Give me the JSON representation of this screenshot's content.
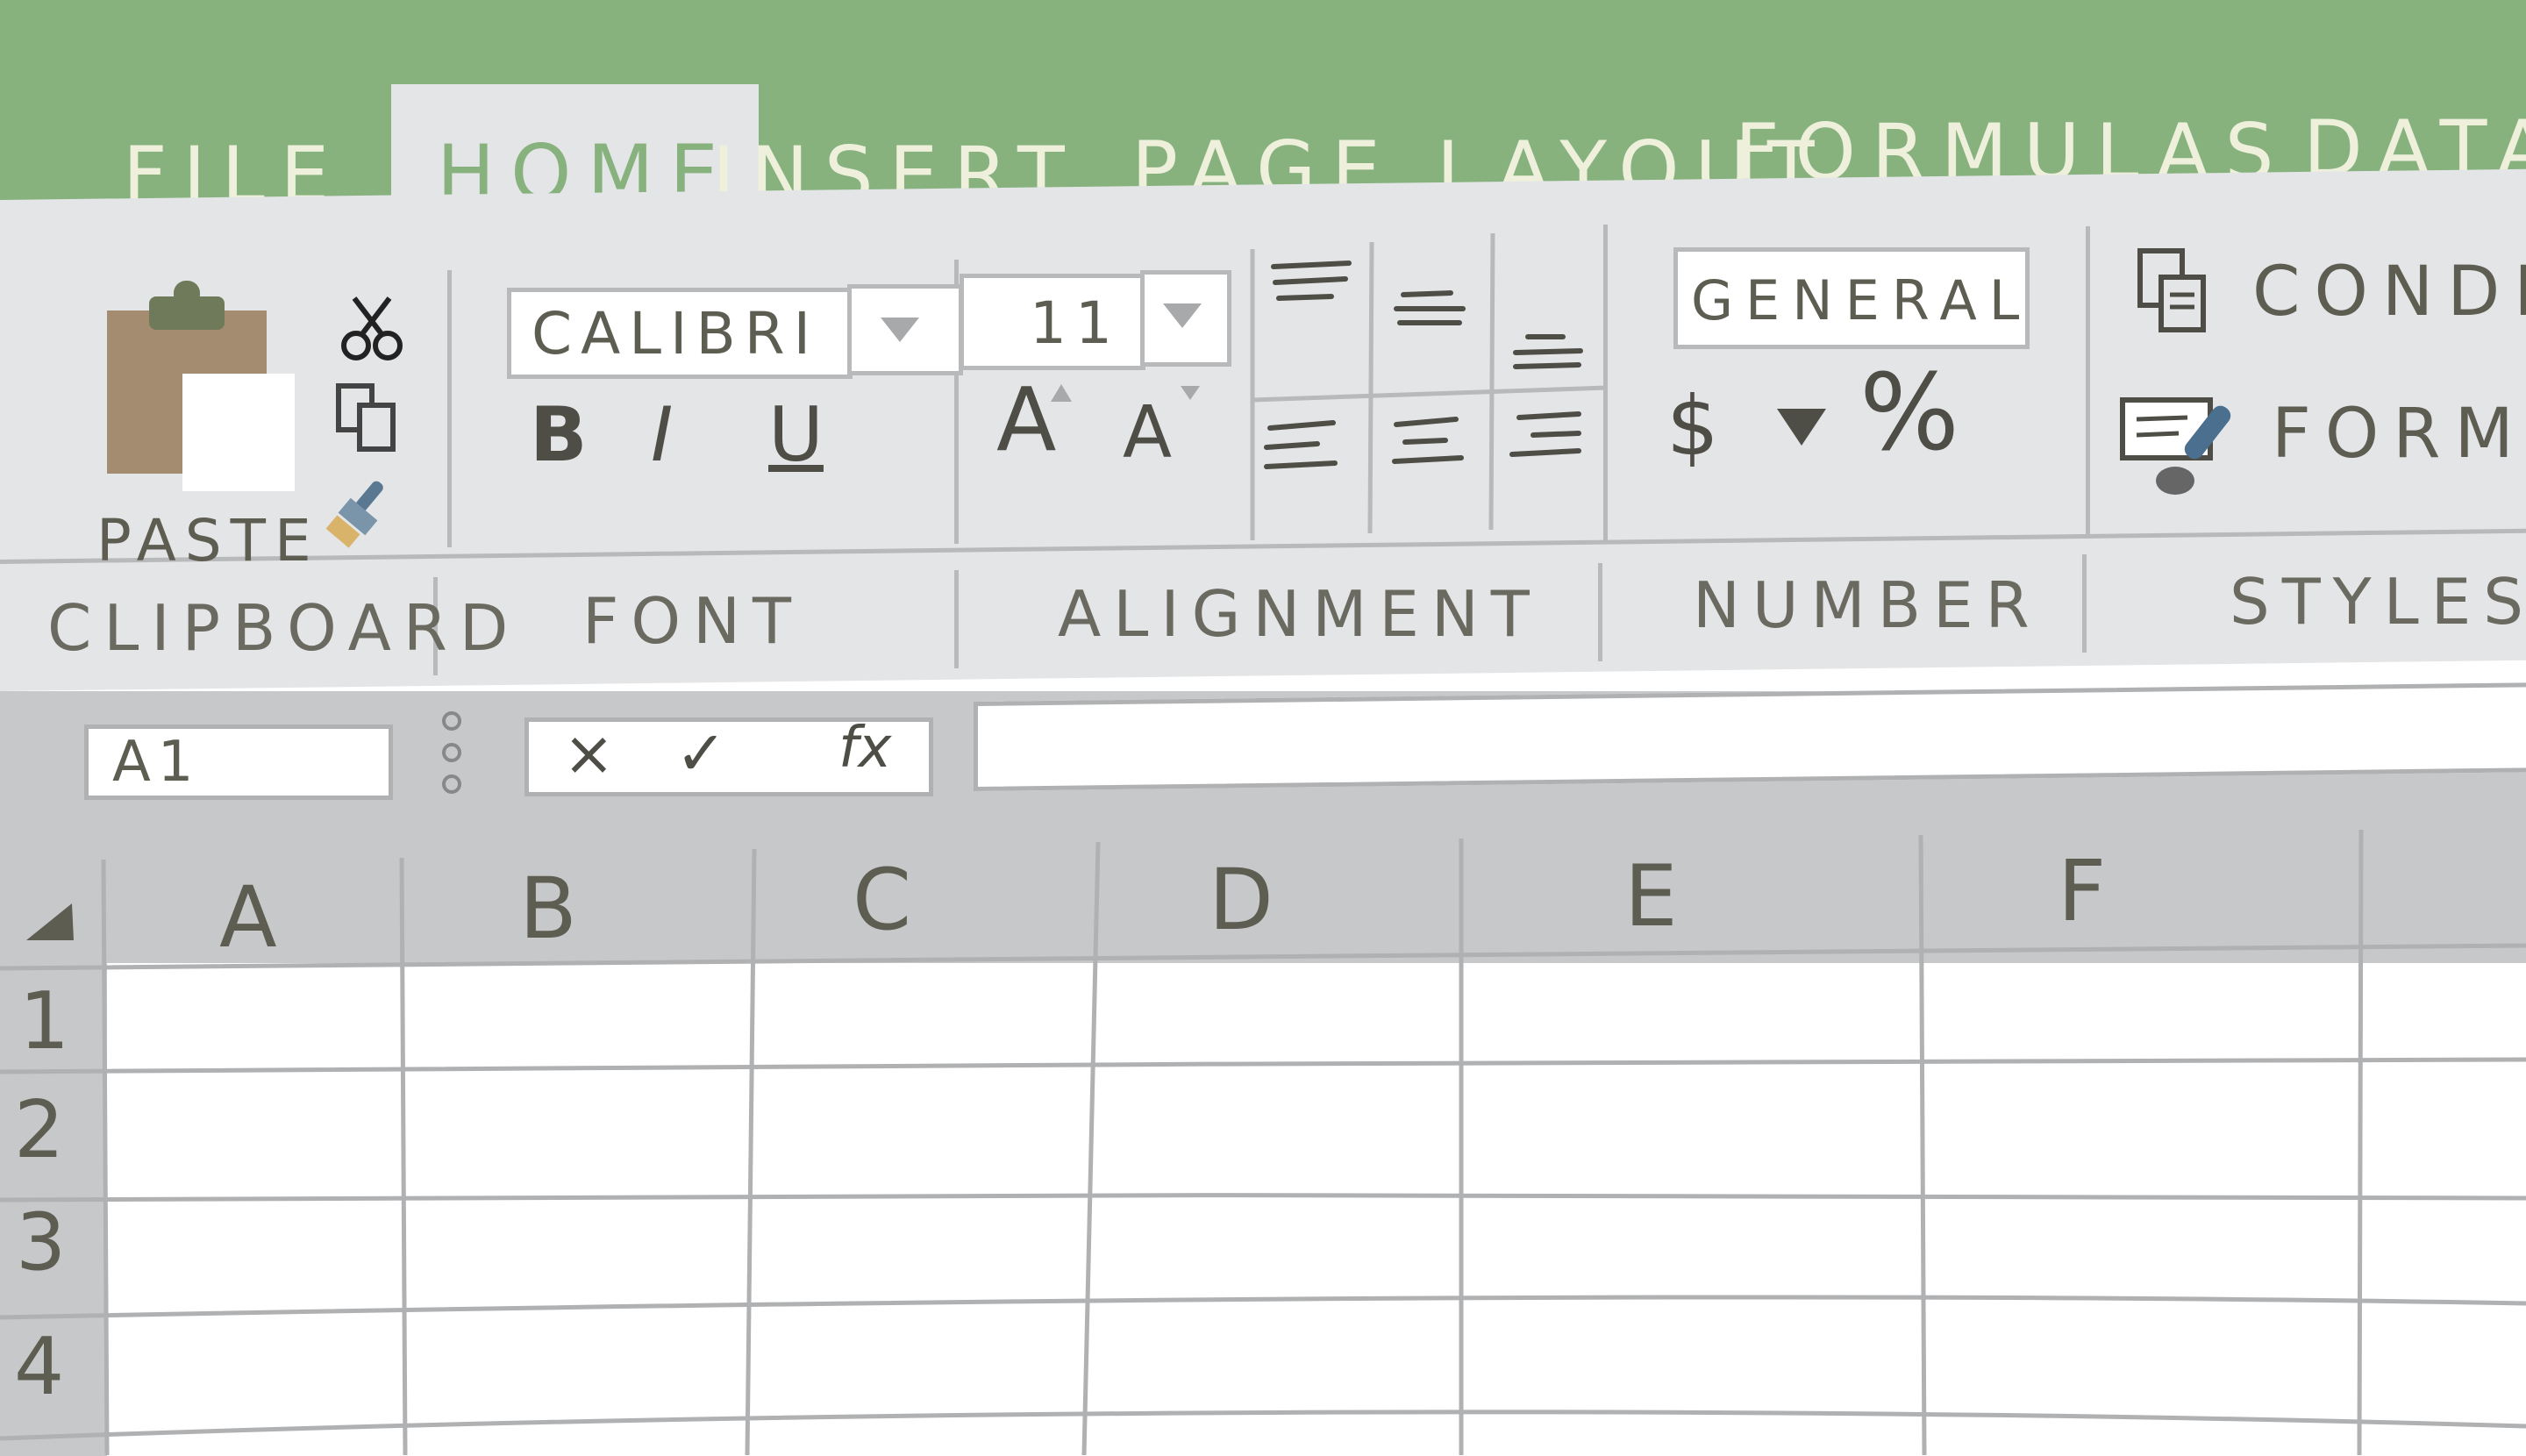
{
  "tabs": [
    {
      "label": "FILE",
      "active": false
    },
    {
      "label": "HOME",
      "active": true
    },
    {
      "label": "INSERT",
      "active": false
    },
    {
      "label": "PAGE LAYOUT",
      "active": false
    },
    {
      "label": "FORMULAS",
      "active": false
    },
    {
      "label": "DATA",
      "active": false
    }
  ],
  "clipboard": {
    "paste_label": "PASTE",
    "group_label": "CLIPBOARD",
    "icons": [
      "clipboard-icon",
      "scissors-icon",
      "copy-icon",
      "format-painter-icon"
    ]
  },
  "font": {
    "family": "CALIBRI",
    "size": "11",
    "bold": "B",
    "italic": "I",
    "underline": "U",
    "grow": "A",
    "shrink": "A",
    "group_label": "FONT"
  },
  "alignment": {
    "group_label": "ALIGNMENT",
    "icons": [
      "align-top-icon",
      "align-middle-icon",
      "align-bottom-icon",
      "align-left-icon",
      "align-center-icon",
      "align-right-icon"
    ]
  },
  "number": {
    "format": "GENERAL",
    "currency": "$",
    "percent": "%",
    "group_label": "NUMBER"
  },
  "styles": {
    "conditional": "CONDITI",
    "format_as": "FORMAT",
    "group_label": "STYLES"
  },
  "formula_bar": {
    "name_box": "A1",
    "cancel": "×",
    "enter": "✓",
    "fx": "fx",
    "formula": ""
  },
  "grid": {
    "columns": [
      "A",
      "B",
      "C",
      "D",
      "E",
      "F"
    ],
    "rows": [
      "1",
      "2",
      "3",
      "4"
    ]
  },
  "colors": {
    "tab_bar": "#87b27e",
    "ribbon": "#e4e5e7",
    "header_band": "#c7c8ca",
    "grid_line": "#b0b1b3"
  }
}
